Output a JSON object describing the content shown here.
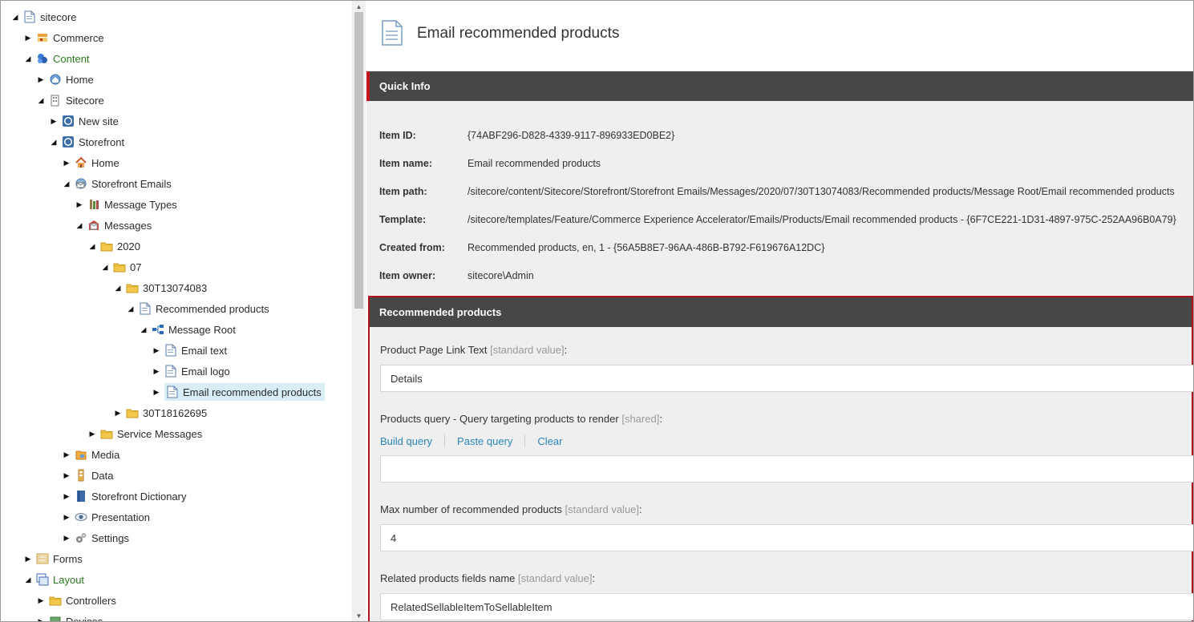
{
  "tree": {
    "nodes": [
      {
        "label": "sitecore",
        "icon": "sitecore-doc-icon"
      },
      {
        "label": "Commerce",
        "icon": "commerce-icon"
      },
      {
        "label": "Content",
        "icon": "content-icon"
      },
      {
        "label": "Home",
        "icon": "home-globe-icon"
      },
      {
        "label": "Sitecore",
        "icon": "building-icon"
      },
      {
        "label": "New site",
        "icon": "globe-icon"
      },
      {
        "label": "Storefront",
        "icon": "globe-icon"
      },
      {
        "label": "Home",
        "icon": "house-icon"
      },
      {
        "label": "Storefront Emails",
        "icon": "email-globe-icon"
      },
      {
        "label": "Message Types",
        "icon": "message-types-icon"
      },
      {
        "label": "Messages",
        "icon": "messages-icon"
      },
      {
        "label": "2020",
        "icon": "folder-icon"
      },
      {
        "label": "07",
        "icon": "folder-icon"
      },
      {
        "label": "30T13074083",
        "icon": "folder-icon"
      },
      {
        "label": "Recommended products",
        "icon": "document-icon"
      },
      {
        "label": "Message Root",
        "icon": "hierarchy-icon"
      },
      {
        "label": "Email text",
        "icon": "document-icon"
      },
      {
        "label": "Email logo",
        "icon": "document-icon"
      },
      {
        "label": "Email recommended products",
        "icon": "document-icon"
      },
      {
        "label": "30T18162695",
        "icon": "folder-icon"
      },
      {
        "label": "Service Messages",
        "icon": "folder-icon"
      },
      {
        "label": "Media",
        "icon": "media-icon"
      },
      {
        "label": "Data",
        "icon": "data-icon"
      },
      {
        "label": "Storefront Dictionary",
        "icon": "dictionary-icon"
      },
      {
        "label": "Presentation",
        "icon": "eye-icon"
      },
      {
        "label": "Settings",
        "icon": "gears-icon"
      },
      {
        "label": "Forms",
        "icon": "forms-icon"
      },
      {
        "label": "Layout",
        "icon": "layout-icon"
      },
      {
        "label": "Controllers",
        "icon": "folder-icon"
      },
      {
        "label": "Devices",
        "icon": "devices-icon"
      }
    ]
  },
  "header": {
    "title": "Email recommended products",
    "icon": "document-icon"
  },
  "quick_info": {
    "title": "Quick Info",
    "rows": [
      {
        "key": "Item ID:",
        "value": "{74ABF296-D828-4339-9117-896933ED0BE2}"
      },
      {
        "key": "Item name:",
        "value": "Email recommended products"
      },
      {
        "key": "Item path:",
        "value": "/sitecore/content/Sitecore/Storefront/Storefront Emails/Messages/2020/07/30T13074083/Recommended products/Message Root/Email recommended products"
      },
      {
        "key": "Template:",
        "value": "/sitecore/templates/Feature/Commerce Experience Accelerator/Emails/Products/Email recommended products - {6F7CE221-1D31-4897-975C-252AA96B0A79}"
      },
      {
        "key": "Created from:",
        "value": "Recommended products, en, 1 - {56A5B8E7-96AA-486B-B792-F619676A12DC}"
      },
      {
        "key": "Item owner:",
        "value": "sitecore\\Admin"
      }
    ]
  },
  "recommended": {
    "title": "Recommended products",
    "fields": {
      "link_text": {
        "label": "Product Page Link Text",
        "hint": "[standard value]",
        "suffix": ":",
        "value": "Details"
      },
      "query": {
        "label": "Products query - Query targeting products to render",
        "hint": "[shared]",
        "suffix": ":",
        "value": ""
      },
      "max": {
        "label": "Max number of recommended products",
        "hint": "[standard value]",
        "suffix": ":",
        "value": "4"
      },
      "related": {
        "label": "Related products fields name",
        "hint": "[standard value]",
        "suffix": ":",
        "value": "RelatedSellableItemToSellableItem"
      }
    },
    "query_links": {
      "build": "Build query",
      "paste": "Paste query",
      "clear": "Clear"
    }
  }
}
